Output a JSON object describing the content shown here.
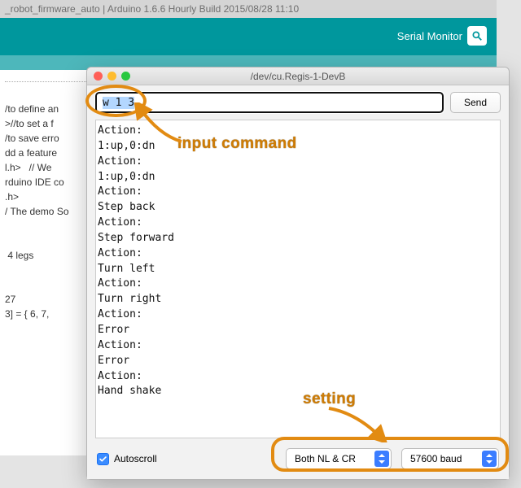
{
  "bg": {
    "title": "_robot_firmware_auto | Arduino 1.6.6 Hourly Build 2015/08/28 11:10",
    "serial_monitor_label": "Serial Monitor",
    "code": "\n/to define an\n>//to set a f\n/to save erro\ndd a feature \nl.h>   // We \nrduino IDE co\n.h>\n/ The demo So\n\n\n 4 legs\n\n\n27\n3] = { 6, 7,"
  },
  "serial": {
    "title": "/dev/cu.Regis-1-DevB",
    "input_value": "w 1 3",
    "send_label": "Send",
    "output": "Action:\n1:up,0:dn\nAction:\n1:up,0:dn\nAction:\nStep back\nAction:\nStep forward\nAction:\nTurn left\nAction:\nTurn right\nAction:\nError\nAction:\nError\nAction:\nHand shake",
    "autoscroll_label": "Autoscroll",
    "autoscroll_checked": true,
    "line_ending": "Both NL & CR",
    "baud": "57600 baud"
  },
  "annotations": {
    "input_command": "input command",
    "setting": "setting"
  },
  "colors": {
    "teal": "#00979d",
    "annotation": "#e28b12"
  }
}
